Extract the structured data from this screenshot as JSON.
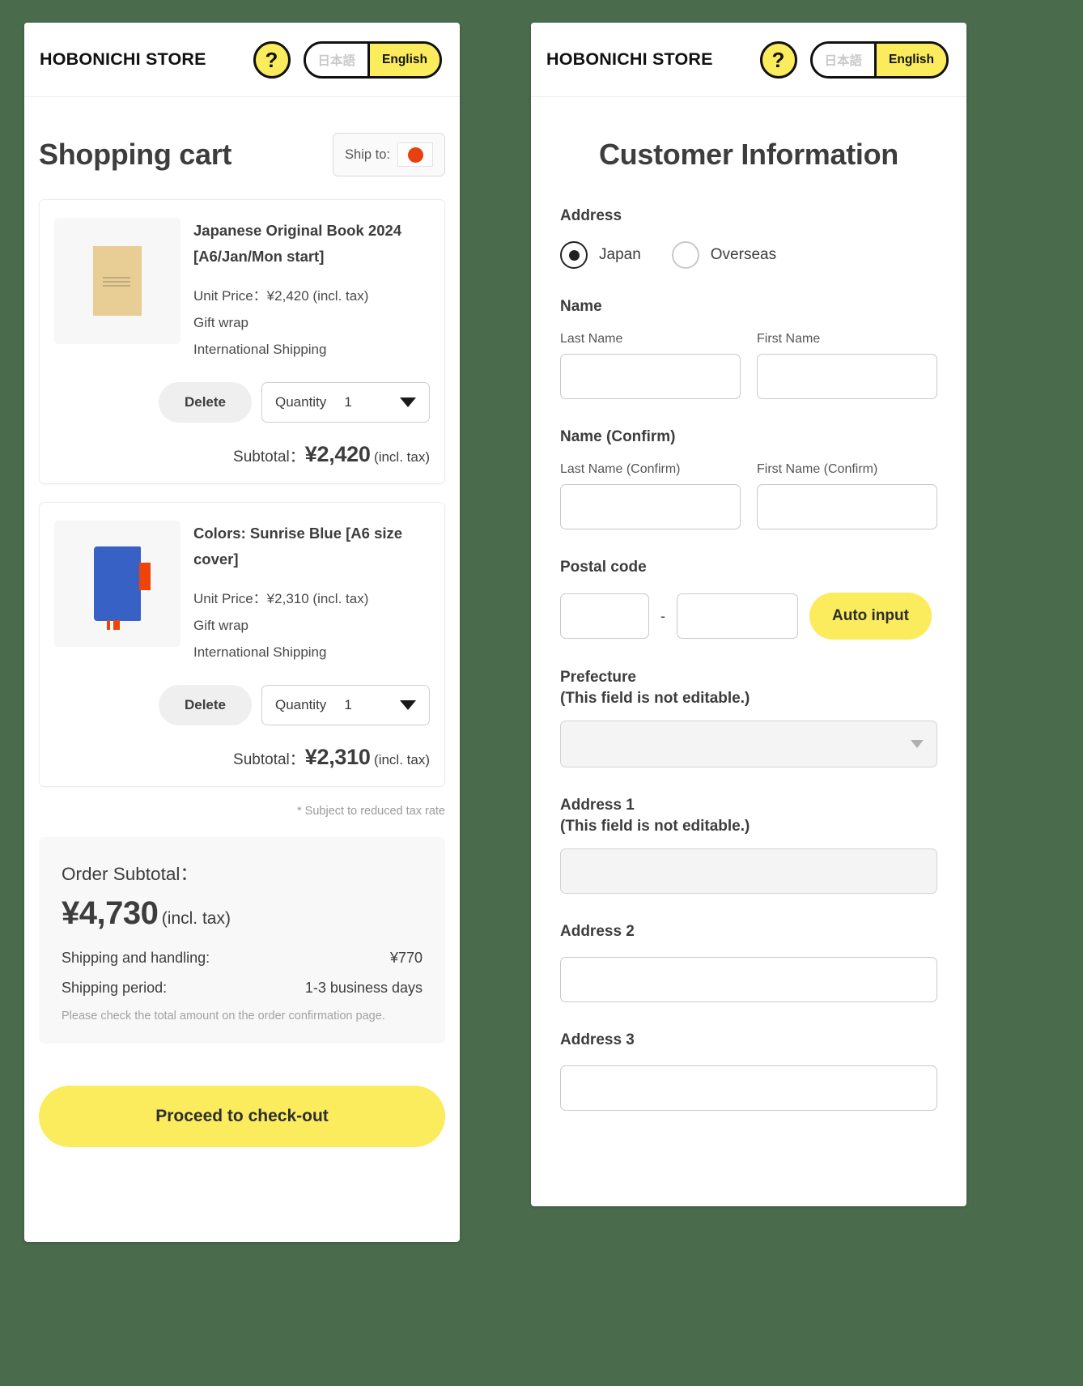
{
  "header": {
    "brand": "HOBONICHI STORE",
    "help_icon": "question-mark-icon",
    "help_label": "?",
    "lang_japanese": "日本語",
    "lang_english": "English",
    "accent_yellow": "#faec5c"
  },
  "cart": {
    "title": "Shopping cart",
    "ship_to_label": "Ship to:",
    "ship_to_flag": "japan-flag-icon",
    "tax_note": "* Subject to reduced tax rate",
    "items": [
      {
        "name": "Japanese Original Book 2024 [A6/Jan/Mon start]",
        "unit_price": "Unit Price：¥2,420 (incl. tax)",
        "gift_wrap": "Gift wrap",
        "shipping": "International Shipping",
        "delete_label": "Delete",
        "quantity_label": "Quantity",
        "quantity_value": "1",
        "subtotal_label": "Subtotal：",
        "subtotal_amount": "¥2,420",
        "subtotal_tax": "(incl. tax)",
        "thumb": "beige-notebook-thumbnail"
      },
      {
        "name": "Colors: Sunrise Blue [A6 size cover]",
        "unit_price": "Unit Price：¥2,310 (incl. tax)",
        "gift_wrap": "Gift wrap",
        "shipping": "International Shipping",
        "delete_label": "Delete",
        "quantity_label": "Quantity",
        "quantity_value": "1",
        "subtotal_label": "Subtotal：",
        "subtotal_amount": "¥2,310",
        "subtotal_tax": "(incl. tax)",
        "thumb": "blue-notebook-thumbnail"
      }
    ],
    "summary": {
      "order_subtotal_label": "Order Subtotal：",
      "order_total": "¥4,730",
      "order_total_tax": "(incl. tax)",
      "shipping_handling_label": "Shipping and handling:",
      "shipping_handling_value": "¥770",
      "shipping_period_label": "Shipping period:",
      "shipping_period_value": "1-3 business days",
      "note": "Please check the total amount on the order confirmation page."
    },
    "checkout_label": "Proceed to check-out"
  },
  "customer": {
    "title": "Customer Information",
    "address_group_label": "Address",
    "radio_japan": "Japan",
    "radio_overseas": "Overseas",
    "selected_region": "Japan",
    "name_group_label": "Name",
    "last_name_label": "Last Name",
    "last_name_value": "",
    "first_name_label": "First Name",
    "first_name_value": "",
    "name_confirm_group_label": "Name (Confirm)",
    "last_name_confirm_label": "Last Name (Confirm)",
    "last_name_confirm_value": "",
    "first_name_confirm_label": "First Name (Confirm)",
    "first_name_confirm_value": "",
    "postal_group_label": "Postal code",
    "postal_part1": "",
    "postal_part2": "",
    "postal_dash": "-",
    "auto_input_label": "Auto input",
    "prefecture_label": "Prefecture",
    "prefecture_note": "(This field is not editable.)",
    "prefecture_value": "",
    "address1_label": "Address 1",
    "address1_note": "(This field is not editable.)",
    "address1_value": "",
    "address2_label": "Address 2",
    "address2_value": "",
    "address3_label": "Address 3",
    "address3_value": ""
  }
}
